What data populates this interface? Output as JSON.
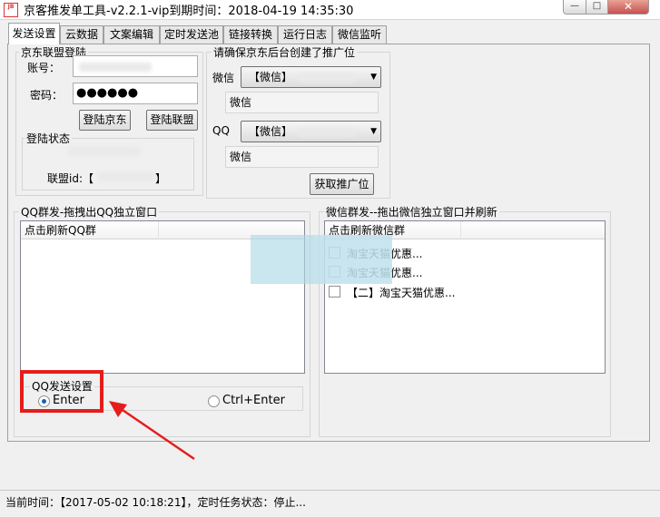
{
  "window": {
    "title": "京客推发单工具-v2.2.1-vip到期时间：2018-04-19 14:35:30",
    "icon_label": "JB",
    "controls": {
      "minimize": "—",
      "maximize": "□",
      "close": "✕"
    }
  },
  "tabs": [
    {
      "label": "发送设置",
      "active": true
    },
    {
      "label": "云数据"
    },
    {
      "label": "文案编辑"
    },
    {
      "label": "定时发送池"
    },
    {
      "label": "链接转换"
    },
    {
      "label": "运行日志"
    },
    {
      "label": "微信监听"
    }
  ],
  "login": {
    "group_title": "京东联盟登陆",
    "account_label": "账号：",
    "password_label": "密码：",
    "password_value": "●●●●●●",
    "login_jd_button": "登陆京东",
    "login_union_button": "登陆联盟"
  },
  "login_status": {
    "group_title": "登陆状态",
    "union_id_label": "联盟id:【",
    "union_id_close": "】"
  },
  "promo": {
    "group_title": "请确保京东后台创建了推广位",
    "wechat_label": "微信",
    "wechat_select": "【微信】",
    "wechat_readonly": "微信",
    "qq_label": "QQ",
    "qq_select": "【微信】",
    "qq_readonly": "微信",
    "fetch_button": "获取推广位"
  },
  "qq_group": {
    "group_title": "QQ群发-拖拽出QQ独立窗口",
    "header": "点击刷新QQ群"
  },
  "wechat_group": {
    "group_title": "微信群发--拖出微信独立窗口并刷新",
    "header": "点击刷新微信群",
    "items": [
      {
        "label": "淘宝天猫优惠..."
      },
      {
        "label": "淘宝天猫优惠..."
      },
      {
        "label": "【二】淘宝天猫优惠..."
      }
    ]
  },
  "qq_send_settings": {
    "group_title": "QQ发送设置",
    "option_enter": "Enter",
    "option_ctrl_enter": "Ctrl+Enter",
    "selected": "Enter"
  },
  "status_bar": {
    "text": "当前时间：【2017-05-02 10:18:21】，定时任务状态：停止..."
  },
  "colors": {
    "annotation": "#e51d1d",
    "overlay": "#add8e6"
  }
}
